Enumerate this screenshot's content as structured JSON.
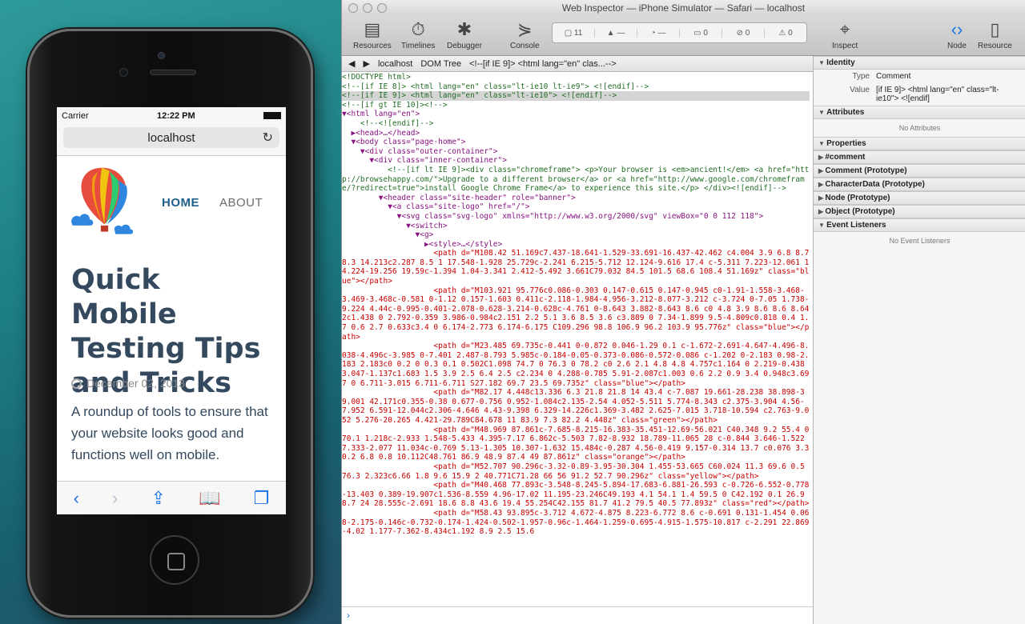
{
  "phone": {
    "carrier": "Carrier",
    "time": "12:22 PM",
    "url": "localhost",
    "nav_home": "HOME",
    "nav_about": "ABOUT",
    "post_title": "Quick Mobile Testing Tips and Tricks",
    "post_date": "December 02, 2013",
    "post_excerpt": "A roundup of tools to ensure that your website looks good and functions well on mobile."
  },
  "inspector": {
    "title": "Web Inspector — iPhone Simulator — Safari — localhost",
    "toolbar": {
      "resources": "Resources",
      "timelines": "Timelines",
      "debugger": "Debugger",
      "console": "Console",
      "inspect": "Inspect",
      "node": "Node",
      "resource": "Resource"
    },
    "status": {
      "resources_count": "11",
      "errors": "0",
      "warnings": "0",
      "logs": "0",
      "issues": "0",
      "dash1": "—",
      "dash2": "—"
    },
    "navbar": {
      "host": "localhost",
      "view": "DOM Tree",
      "crumb": "<!--[if IE 9]>  <html lang=\"en\" clas...-->"
    },
    "dom_lines": [
      {
        "t": "<!DOCTYPE html>",
        "c": "c-cmt"
      },
      {
        "t": "<!--[if IE 8]> <html lang=\"en\" class=\"lt-ie10 lt-ie9\"> <![endif]-->",
        "c": "c-cmt"
      },
      {
        "t": "<!--[if IE 9]> <html lang=\"en\" class=\"lt-ie10\"> <![endif]-->",
        "c": "c-cmt sel"
      },
      {
        "t": "<!--[if gt IE 10]><!-->",
        "c": "c-cmt"
      },
      {
        "t": "▼<html lang=\"en\">",
        "c": "c-tag"
      },
      {
        "t": "    <!--<![endif]-->",
        "c": "c-cmt"
      },
      {
        "t": "  ▶<head>…</head>",
        "c": "c-tag"
      },
      {
        "t": "  ▼<body class=\"page-home\">",
        "c": "c-tag"
      },
      {
        "t": "    ▼<div class=\"outer-container\">",
        "c": "c-tag"
      },
      {
        "t": "      ▼<div class=\"inner-container\">",
        "c": "c-tag"
      },
      {
        "t": "          <!--[if lt IE 9]><div class=\"chromeframe\"> <p>Your browser is <em>ancient!</em> <a href=\"http://browsehappy.com/\">Upgrade to a different browser</a> or <a href=\"http://www.google.com/chromeframe/?redirect=true\">install Google Chrome Frame</a> to experience this site.</p> </div><![endif]-->",
        "c": "c-cmt"
      },
      {
        "t": "        ▼<header class=\"site-header\" role=\"banner\">",
        "c": "c-tag"
      },
      {
        "t": "          ▼<a class=\"site-logo\" href=\"/\">",
        "c": "c-tag"
      },
      {
        "t": "            ▼<svg class=\"svg-logo\" xmlns=\"http://www.w3.org/2000/svg\" viewBox=\"0 0 112 118\">",
        "c": "c-tag"
      },
      {
        "t": "              ▼<switch>",
        "c": "c-tag"
      },
      {
        "t": "                ▼<g>",
        "c": "c-tag"
      },
      {
        "t": "                  ▶<style>…</style>",
        "c": "c-tag"
      },
      {
        "t": "                    <path d=\"M108.42 51.169c7.437-18.641-1.529-33.691-16.437-42.462 c4.004 3.9 6.8 8.7 8.3 14.213c2.287 8.5 1 17.548-1.928 25.729c-2.241 6.215-5.712 12.124-9.616 17.4 c-5.311 7.223-12.061 14.224-19.256 19.59c-1.394 1.04-3.341 2.412-5.492 3.661C79.032 84.5 101.5 68.6 108.4 51.169z\" class=\"blue\"></path>",
        "c": "c-red"
      },
      {
        "t": "                    <path d=\"M103.921 95.776c0.086-0.303 0.147-0.615 0.147-0.945 c0-1.91-1.558-3.468-3.469-3.468c-0.581 0-1.12 0.157-1.603 0.411c-2.118-1.984-4.956-3.212-8.077-3.212 c-3.724 0-7.05 1.738-9.224 4.44c-0.995-0.401-2.078-0.628-3.214-0.628c-4.761 0-8.643 3.882-8.643 8.6 c0 4.8 3.9 8.6 8.6 8.642c1.438 0 2.792-0.359 3.986-0.984c2.151 2.2 5.1 3.6 8.5 3.6 c3.889 0 7.34-1.899 9.5-4.809c0.818 0.4 1.7 0.6 2.7 0.633c3.4 0 6.174-2.773 6.174-6.175 C109.296 98.8 106.9 96.2 103.9 95.776z\" class=\"blue\"></path>",
        "c": "c-red"
      },
      {
        "t": "                    <path d=\"M23.485 69.735c-0.441 0-0.872 0.046-1.29 0.1 c-1.672-2.691-4.647-4.496-8.038-4.496c-3.985 0-7.401 2.487-8.793 5.985c-0.184-0.05-0.373-0.086-0.572-0.086 c-1.202 0-2.183 0.98-2.183 2.183c0 0.2 0 0.3 0.1 0.502C1.098 74.7 0 76.3 0 78.2 c0 2.6 2.1 4.8 4.8 4.757c1.164 0 2.219-0.438 3.047-1.137c1.683 1.5 3.9 2.5 6.4 2.5 c2.234 0 4.288-0.785 5.91-2.087c1.003 0.6 2.2 0.9 3.4 0.948c3.697 0 6.711-3.015 6.711-6.711 S27.182 69.7 23.5 69.735z\" class=\"blue\"></path>",
        "c": "c-red"
      },
      {
        "t": "                    <path d=\"M82.17 4.448c13.336 6.3 21.8 21.8 14 43.4 c-7.087 19.661-28.238 38.898-39.001 42.171c0.355-0.38 0.677-0.756 0.952-1.084c2.135-2.54 4.052-5.511 5.774-8.343 c2.375-3.904 4.56-7.952 6.591-12.044c2.306-4.646 4.43-9.398 6.329-14.226c1.369-3.482 2.625-7.015 3.718-10.594 c2.763-9.052 5.276-20.265 4.421-29.789C84.678 11 83.9 7.3 82.2 4.448z\" class=\"green\"></path>",
        "c": "c-red"
      },
      {
        "t": "                    <path d=\"M48.969 87.861c-7.685-8.215-16.383-35.451-12.69-56.021 C40.348 9.2 55.4 0 70.1 1.218c-2.933 1.548-5.433 4.395-7.17 6.862c-5.503 7.82-8.932 18.789-11.065 28 c-0.844 3.646-1.522 7.333-2.077 11.034c-0.769 5.13-1.305 10.307-1.632 15.484c-0.287 4.56-0.419 9.157-0.314 13.7 c0.076 3.3 0.2 6.8 0.8 10.112C48.761 86.9 48.9 87.4 49 87.861z\" class=\"orange\"></path>",
        "c": "c-red"
      },
      {
        "t": "                    <path d=\"M52.707 90.296c-3.32-0.89-3.95-30.304 1.455-53.665 C60.024 11.3 69.6 0.5 76.3 2.323c6.66 1.8 9.6 15.9 2 40.771C71.28 66 56 91.2 52.7 90.296z\" class=\"yellow\"></path>",
        "c": "c-red"
      },
      {
        "t": "                    <path d=\"M40.468 77.893c-3.548-8.245-5.894-17.683-6.881-26.593 c-0.726-6.552-0.778-13.403 0.389-19.907c1.536-8.559 4.96-17.02 11.195-23.246C49.193 4.1 54.1 1.4 59.5 0 C42.192 0.1 26.9 8.7 24 28.555c-2.691 18.6 8.8 43.6 19.4 55.254C42.155 81.7 41.2 79.5 40.5 77.893z\" class=\"red\"></path>",
        "c": "c-red"
      },
      {
        "t": "                    <path d=\"M58.43 93.895c-3.712 4.672-4.875 8.223-6.772 8.6 c-0.691 0.131-1.454 0.068-2.175-0.146c-0.732-0.174-1.424-0.502-1.957-0.96c-1.464-1.259-0.695-4.915-1.575-10.817 c-2.291 22.869-4.02 1.177-7.362-8.434c1.192 8.9 2.5 15.6",
        "c": "c-red"
      }
    ],
    "sidebar": {
      "identity": "Identity",
      "type_label": "Type",
      "type_value": "Comment",
      "value_label": "Value",
      "value_value": "[if IE 9]>  <html lang=\"en\" class=\"lt-ie10\">  <![endif]",
      "attributes": "Attributes",
      "no_attributes": "No Attributes",
      "properties": "Properties",
      "props": [
        "#comment",
        "Comment (Prototype)",
        "CharacterData (Prototype)",
        "Node (Prototype)",
        "Object (Prototype)"
      ],
      "event_listeners": "Event Listeners",
      "no_event_listeners": "No Event Listeners"
    },
    "console_prompt": "›"
  },
  "colors": {
    "accent": "#1a73e8",
    "title_text": "#34495e",
    "nav_active": "#1f5f8b"
  }
}
